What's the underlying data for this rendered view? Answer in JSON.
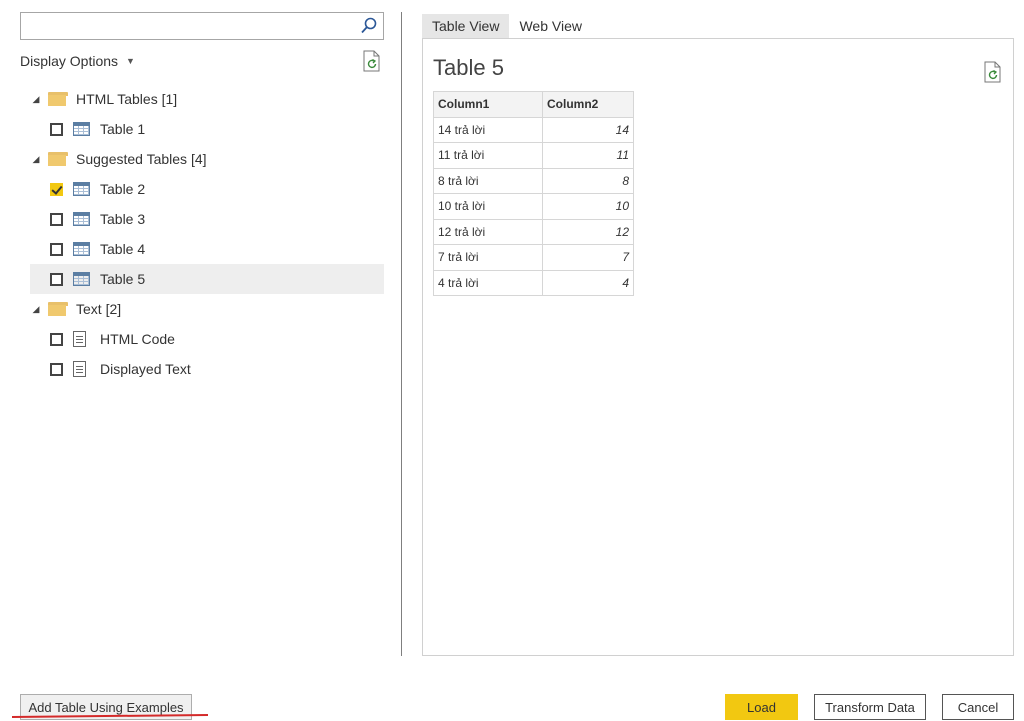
{
  "search": {
    "value": "",
    "placeholder": ""
  },
  "navigator": {
    "display_options_label": "Display Options",
    "groups": [
      {
        "label": "HTML Tables [1]",
        "items": [
          {
            "label": "Table 1",
            "checked": false,
            "icon": "table-icon"
          }
        ]
      },
      {
        "label": "Suggested Tables [4]",
        "items": [
          {
            "label": "Table 2",
            "checked": true,
            "icon": "table-icon"
          },
          {
            "label": "Table 3",
            "checked": false,
            "icon": "table-icon"
          },
          {
            "label": "Table 4",
            "checked": false,
            "icon": "table-icon"
          },
          {
            "label": "Table 5",
            "checked": false,
            "icon": "table-icon",
            "selected": true
          }
        ]
      },
      {
        "label": "Text [2]",
        "items": [
          {
            "label": "HTML Code",
            "checked": false,
            "icon": "document-icon"
          },
          {
            "label": "Displayed Text",
            "checked": false,
            "icon": "document-icon"
          }
        ]
      }
    ]
  },
  "preview": {
    "tabs": [
      {
        "label": "Table View",
        "active": true
      },
      {
        "label": "Web View",
        "active": false
      }
    ],
    "title": "Table 5",
    "columns": [
      "Column1",
      "Column2"
    ],
    "rows": [
      [
        "14 trả lời",
        "14"
      ],
      [
        "11 trả lời",
        "11"
      ],
      [
        "8 trả lời",
        "8"
      ],
      [
        "10 trả lời",
        "10"
      ],
      [
        "12 trả lời",
        "12"
      ],
      [
        "7 trả lời",
        "7"
      ],
      [
        "4 trả lời",
        "4"
      ]
    ]
  },
  "footer": {
    "add_table_label": "Add Table Using Examples",
    "load_label": "Load",
    "transform_label": "Transform Data",
    "cancel_label": "Cancel"
  },
  "colors": {
    "accent": "#f2c811",
    "folder": "#f0c96e",
    "underline": "#d42a2a"
  }
}
